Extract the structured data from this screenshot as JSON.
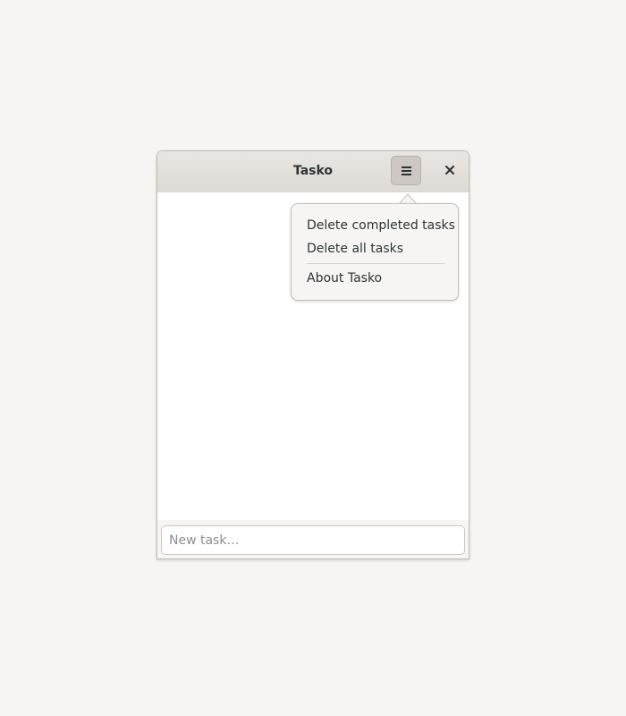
{
  "window": {
    "title": "Tasko"
  },
  "headerbar": {
    "menu_icon": "hamburger-menu-icon",
    "close_icon": "close-icon"
  },
  "menu": {
    "items": [
      {
        "label": "Delete completed tasks"
      },
      {
        "label": "Delete all tasks"
      },
      {
        "label": "About Tasko"
      }
    ]
  },
  "footer": {
    "entry_placeholder": "New task…",
    "entry_value": ""
  },
  "colors": {
    "desktop_bg": "#f6f5f4",
    "headerbar_bg": "#e2dfdc",
    "menu_button_active": "#cdc8c3",
    "text": "#2e3436"
  }
}
